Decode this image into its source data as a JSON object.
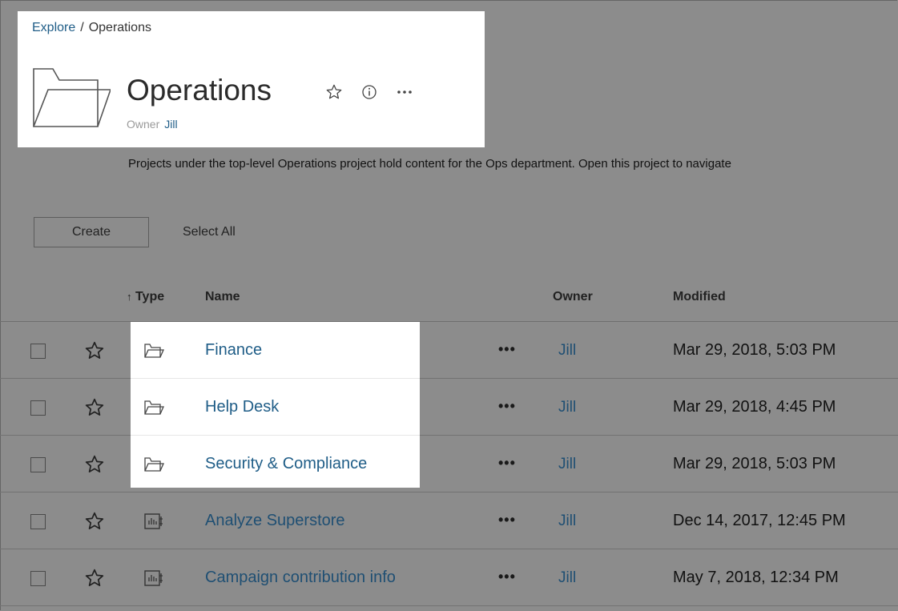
{
  "breadcrumb": {
    "root": "Explore",
    "separator": "/",
    "current": "Operations"
  },
  "project": {
    "title": "Operations",
    "owner_label": "Owner",
    "owner_name": "Jill",
    "description": "Projects under the top-level Operations project hold content for the Ops department. Open this project to navigate"
  },
  "header_icons": [
    "star-icon",
    "info-icon",
    "more-icon"
  ],
  "toolbar": {
    "create_label": "Create",
    "select_all_label": "Select All"
  },
  "columns": {
    "type": "Type",
    "sort_indicator": "↑",
    "name": "Name",
    "owner": "Owner",
    "modified": "Modified"
  },
  "actions_label": "•••",
  "rows": [
    {
      "type": "project",
      "name": "Finance",
      "owner": "Jill",
      "modified": "Mar 29, 2018, 5:03 PM"
    },
    {
      "type": "project",
      "name": "Help Desk",
      "owner": "Jill",
      "modified": "Mar 29, 2018, 4:45 PM"
    },
    {
      "type": "project",
      "name": "Security & Compliance",
      "owner": "Jill",
      "modified": "Mar 29, 2018, 5:03 PM"
    },
    {
      "type": "workbook",
      "name": "Analyze Superstore",
      "owner": "Jill",
      "modified": "Dec 14, 2017, 12:45 PM"
    },
    {
      "type": "workbook",
      "name": "Campaign contribution info",
      "owner": "Jill",
      "modified": "May 7, 2018, 12:34 PM"
    }
  ],
  "colors": {
    "link": "#1f5d87",
    "dim_link": "#1f4f73",
    "overlay": "#8c8c8c",
    "highlight": "#ffffff"
  }
}
